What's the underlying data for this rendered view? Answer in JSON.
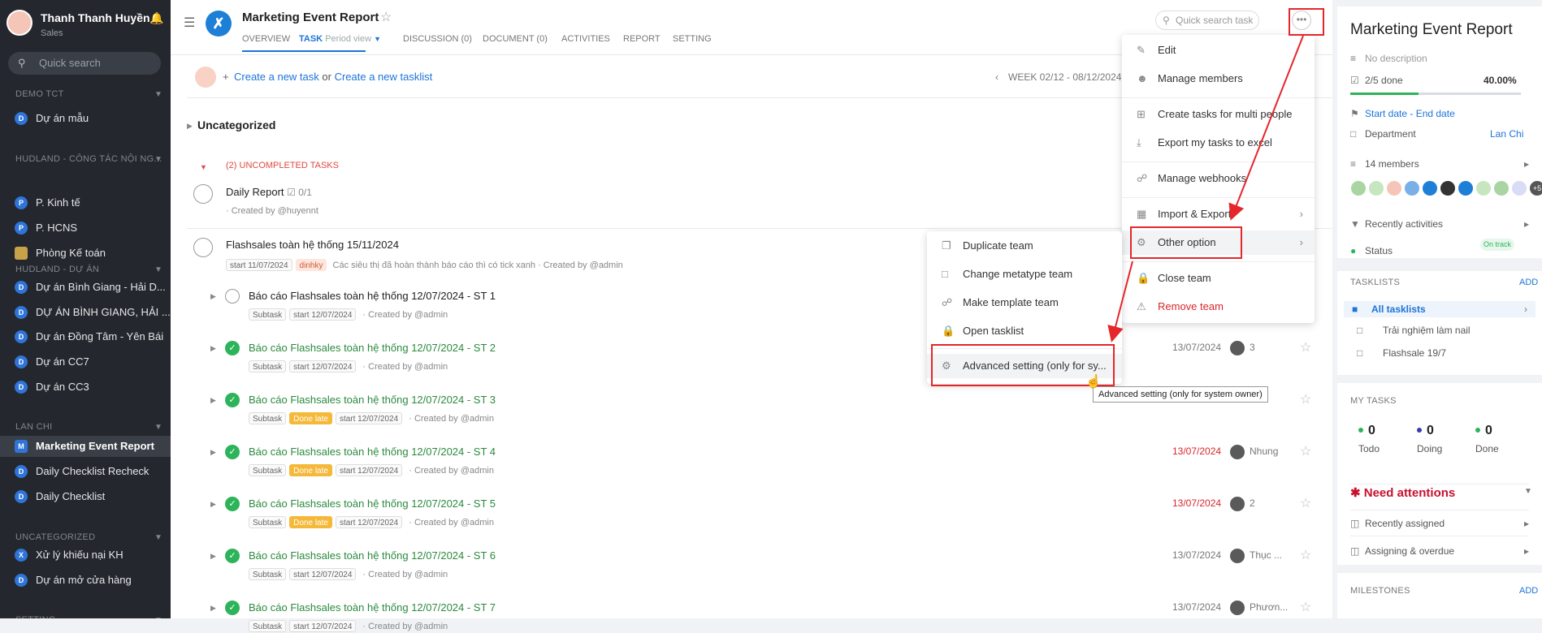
{
  "sidebar": {
    "user_name": "Thanh Thanh Huyền",
    "user_role": "Sales",
    "search_placeholder": "Quick search",
    "groups": [
      {
        "title": "DEMO TCT",
        "items": [
          {
            "label": "Dự án mẫu",
            "badge": "D"
          }
        ]
      },
      {
        "title": "HUDLAND - CÔNG TÁC NỘI NG...",
        "items": [
          {
            "label": "P. Kinh tế",
            "badge": "P"
          },
          {
            "label": "P. HCNS",
            "badge": "P"
          },
          {
            "label": "Phòng Kế toán",
            "badge": ""
          }
        ]
      },
      {
        "title": "HUDLAND - DỰ ÁN",
        "items": [
          {
            "label": "Dự án Bình Giang - Hải D...",
            "badge": "D"
          },
          {
            "label": "DỰ ÁN BÌNH GIANG, HẢI ...",
            "badge": "D"
          },
          {
            "label": "Dự án Đồng Tâm - Yên Bái",
            "badge": "D"
          },
          {
            "label": "Dự án CC7",
            "badge": "D"
          },
          {
            "label": "Dự án CC3",
            "badge": "D"
          }
        ]
      },
      {
        "title": "LAN CHI",
        "items": [
          {
            "label": "Marketing Event Report",
            "badge": "M",
            "active": true
          },
          {
            "label": "Daily Checklist Recheck",
            "badge": "D"
          },
          {
            "label": "Daily Checklist",
            "badge": "D"
          }
        ]
      },
      {
        "title": "UNCATEGORIZED",
        "items": [
          {
            "label": "Xử lý khiếu nại KH",
            "badge": "X"
          },
          {
            "label": "Dự án mở cửa hàng",
            "badge": "D"
          }
        ]
      },
      {
        "title": "SETTING",
        "items": []
      }
    ]
  },
  "header": {
    "title": "Marketing Event Report",
    "tabs": [
      "OVERVIEW",
      "TASK",
      "DISCUSSION (0)",
      "DOCUMENT (0)",
      "ACTIVITIES",
      "REPORT",
      "SETTING"
    ],
    "period_view": "Period view",
    "search_placeholder": "Quick search task",
    "more": "•••"
  },
  "create": {
    "new_task": "Create a new task",
    "or": " or ",
    "new_tasklist": "Create a new tasklist"
  },
  "week": "WEEK 02/12 - 08/12/2024",
  "section": "Uncategorized",
  "uncompleted": "(2) UNCOMPLETED TASKS",
  "tasks": [
    {
      "title": "Daily Report",
      "check": "0/1",
      "meta": "· Created by @huyennt"
    },
    {
      "title": "Flashsales toàn hệ thống 15/11/2024",
      "start": "start 11/07/2024",
      "tag": "dinhky",
      "meta": "Các siêu thị đã hoàn thành báo cáo thì có tick xanh · Created by @admin"
    }
  ],
  "subtasks": [
    {
      "title": "Báo cáo Flashsales toàn hệ thống 12/07/2024 - ST 1",
      "done": false,
      "late": false,
      "date": "",
      "assignee": ""
    },
    {
      "title": "Báo cáo Flashsales toàn hệ thống 12/07/2024 - ST 2",
      "done": true,
      "late": false,
      "date": "13/07/2024",
      "assignee": "3"
    },
    {
      "title": "Báo cáo Flashsales toàn hệ thống 12/07/2024 - ST 3",
      "done": true,
      "late": true,
      "date": "",
      "assignee": ""
    },
    {
      "title": "Báo cáo Flashsales toàn hệ thống 12/07/2024 - ST 4",
      "done": true,
      "late": true,
      "date": "13/07/2024",
      "date_red": true,
      "assignee": "Nhung"
    },
    {
      "title": "Báo cáo Flashsales toàn hệ thống 12/07/2024 - ST 5",
      "done": true,
      "late": true,
      "date": "13/07/2024",
      "date_red": true,
      "assignee": "2"
    },
    {
      "title": "Báo cáo Flashsales toàn hệ thống 12/07/2024 - ST 6",
      "done": true,
      "late": false,
      "date": "13/07/2024",
      "assignee": "Thục ..."
    },
    {
      "title": "Báo cáo Flashsales toàn hệ thống 12/07/2024 - ST 7",
      "done": true,
      "late": false,
      "date": "13/07/2024",
      "assignee": "Phươn..."
    }
  ],
  "subtask_labels": {
    "subtask": "Subtask",
    "done_late": "Done late",
    "start": "start 12/07/2024",
    "created": "· Created by @admin"
  },
  "menu": {
    "items": [
      "Edit",
      "Manage members",
      "Create tasks for multi people",
      "Export my tasks to excel",
      "Manage webhooks",
      "Import & Export",
      "Other option",
      "Close team",
      "Remove team"
    ]
  },
  "submenu": {
    "items": [
      "Duplicate team",
      "Change metatype team",
      "Make template team",
      "Open tasklist",
      "Advanced setting (only for sy..."
    ]
  },
  "tooltip": "Advanced setting (only for system owner)",
  "right": {
    "title": "Marketing Event Report",
    "no_desc": "No description",
    "done": "2/5 done",
    "percent": "40.00%",
    "progress": 0.4,
    "start_end": "Start date - End date",
    "department": "Department",
    "department_val": "Lan Chi",
    "members": "14 members",
    "more_members": "+5",
    "recent": "Recently activities",
    "status": "Status",
    "status_val": "On track",
    "tasklists_head": "TASKLISTS",
    "add": "ADD",
    "tasklists": [
      "All tasklists",
      "Trải nghiệm làm nail",
      "Flashsale 19/7"
    ],
    "mytasks_head": "MY TASKS",
    "counts": [
      {
        "n": "0",
        "label": "Todo",
        "color": "#2db45a"
      },
      {
        "n": "0",
        "label": "Doing",
        "color": "#3a3ab0"
      },
      {
        "n": "0",
        "label": "Done",
        "color": "#2db45a"
      }
    ],
    "need": "Need attentions",
    "assigned": "Recently assigned",
    "overdue": "Assigning & overdue",
    "milestones": "MILESTONES"
  }
}
